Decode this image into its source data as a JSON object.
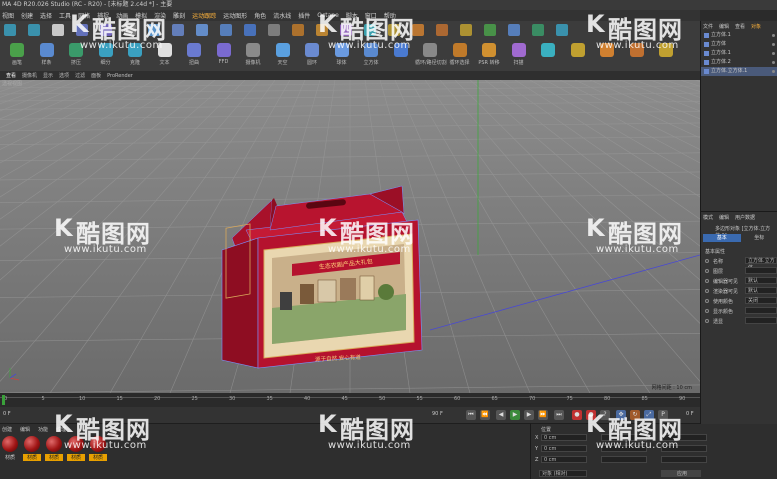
{
  "app": {
    "title": "MA 4D R20.026 Studio (RC - R20) - [未标题 2.c4d *] - 主要"
  },
  "menu": [
    "视图",
    "创建",
    "选择",
    "工具",
    "网格",
    "捕捉",
    "动画",
    "模拟",
    "渲染",
    "雕刻",
    "运动跟踪",
    "运动图形",
    "角色",
    "流水线",
    "插件",
    "Octane",
    "脚本",
    "窗口",
    "帮助"
  ],
  "menu_highlight": "运动跟踪",
  "toolbar": {
    "labels": [
      "画笔",
      "样条",
      "挤压",
      "细分",
      "克隆",
      "文本",
      "扭曲",
      "FFD",
      "摄像机",
      "天空",
      "圆环",
      "球体",
      "立方体",
      "",
      "循环/路径切割",
      "循环选择",
      "PSR 转移",
      "扫描",
      "",
      "",
      "",
      "",
      ""
    ]
  },
  "view_tabs": [
    "查看",
    "摄像机",
    "显示",
    "选项",
    "过滤",
    "面板",
    "ProRender"
  ],
  "view_tab_active": "查看",
  "viewport": {
    "label": "透视视图",
    "grid_info": "网格间距 : 10 cm"
  },
  "timeline": {
    "ticks": [
      "0",
      "5",
      "10",
      "15",
      "20",
      "25",
      "30",
      "35",
      "40",
      "45",
      "50",
      "55",
      "60",
      "65",
      "70",
      "75",
      "80",
      "85",
      "90"
    ],
    "frame_start": "0 F",
    "frame_end": "90 F",
    "frame_end_alt": "0 F"
  },
  "materials": {
    "tabs": [
      "创建",
      "编辑",
      "功能",
      "纹理"
    ],
    "items": [
      "材质",
      "材质",
      "材质",
      "材质",
      "材质"
    ]
  },
  "coordinates": {
    "header": "位置",
    "rows": [
      {
        "axis": "X",
        "value": "0 cm"
      },
      {
        "axis": "Y",
        "value": "0 cm"
      },
      {
        "axis": "Z",
        "value": "0 cm"
      }
    ],
    "mode": "对象 (相对)",
    "apply": "应用"
  },
  "objects": {
    "tabs": [
      "文件",
      "编辑",
      "查看",
      "对象"
    ],
    "items": [
      "立方体.1",
      "立方体",
      "立方体.1",
      "立方体.2",
      "立方体.立方体.1"
    ]
  },
  "attributes": {
    "tabs": [
      "模式",
      "编辑",
      "用户数据"
    ],
    "object_name": "多边形对象 [立方体.立方体.1]",
    "sub_tabs": [
      "基本",
      "坐标"
    ],
    "section": "基本属性",
    "props": [
      {
        "label": "名称",
        "value": "立方体.立方体"
      },
      {
        "label": "图层",
        "value": ""
      },
      {
        "label": "编辑器可见",
        "value": "默认"
      },
      {
        "label": "渲染器可见",
        "value": "默认"
      },
      {
        "label": "使用颜色",
        "value": "关闭"
      },
      {
        "label": "显示颜色",
        "value": ""
      },
      {
        "label": "透显",
        "value": ""
      }
    ]
  },
  "box": {
    "banner": "生态农副产品大礼包",
    "footer": "源于自然 安心有道"
  },
  "watermark": {
    "brand": "酷图网",
    "url": "www.ikutu.com"
  },
  "colors": {
    "accent_orange": "#e8a000",
    "box_red": "#b5122e",
    "box_dark": "#8e0d22"
  }
}
